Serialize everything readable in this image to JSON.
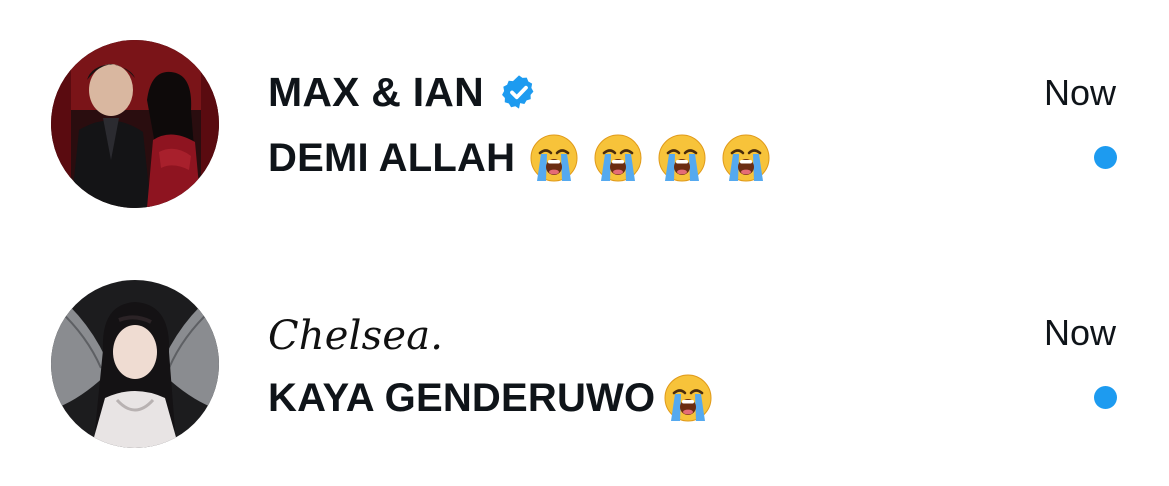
{
  "conversations": [
    {
      "name": "MAX & IAN",
      "verified": true,
      "message": "DEMI ALLAH",
      "emoji_count": 4,
      "emoji": "loudly-crying-face",
      "time": "Now",
      "unread": true
    },
    {
      "name": "Chelsea.",
      "verified": false,
      "message": "KAYA GENDERUWO",
      "emoji_count": 1,
      "emoji": "loudly-crying-face",
      "time": "Now",
      "unread": true
    }
  ],
  "colors": {
    "accent": "#1d9bf0",
    "text": "#0f1419",
    "background": "#ffffff"
  }
}
